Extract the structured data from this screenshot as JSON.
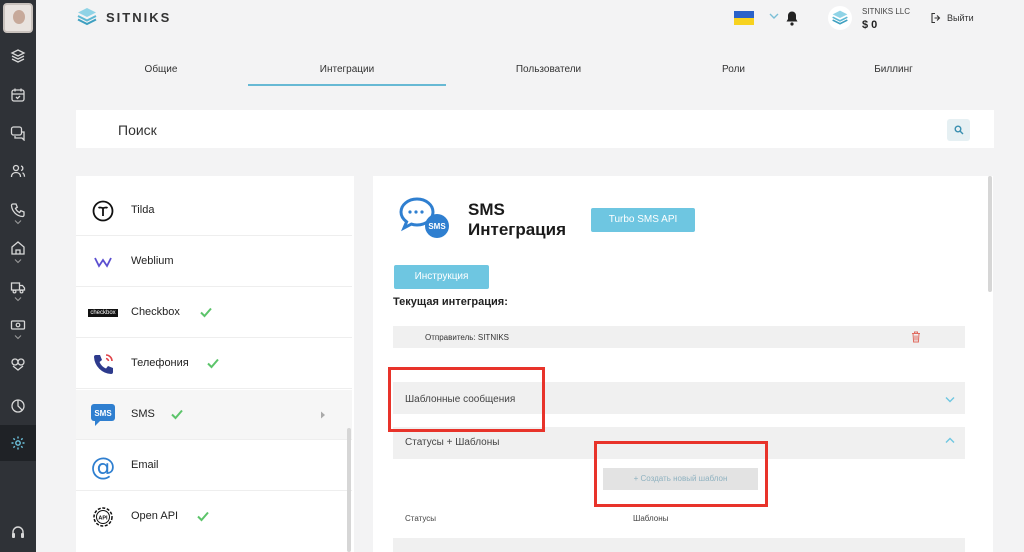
{
  "brand": {
    "name": "SITNIKS",
    "accent": "#6ec6e1",
    "sidebar_bg": "#2f3237",
    "highlight": "#e8332a"
  },
  "header": {
    "account_name": "SITNIKS LLC",
    "balance": "$ 0",
    "logout": "Выйти"
  },
  "sidebar_icons": [
    "layers-icon",
    "calendar-icon",
    "chat-icon",
    "users-icon",
    "phone-icon",
    "home-icon",
    "truck-icon",
    "cash-icon",
    "handshake-icon",
    "pie-chart-icon",
    "settings-icon",
    "headset-icon"
  ],
  "tabs": [
    {
      "label": "Общие",
      "active": false
    },
    {
      "label": "Интеграции",
      "active": true
    },
    {
      "label": "Пользователи",
      "active": false
    },
    {
      "label": "Роли",
      "active": false
    },
    {
      "label": "Биллинг",
      "active": false
    }
  ],
  "search": {
    "label": "Поиск"
  },
  "integrations": [
    {
      "label": "Tilda",
      "icon": "tilda-icon",
      "connected": false
    },
    {
      "label": "Weblium",
      "icon": "weblium-icon",
      "connected": false
    },
    {
      "label": "Checkbox",
      "icon": "checkbox-logo-icon",
      "icon_text": "checkbox",
      "connected": true
    },
    {
      "label": "Телефония",
      "icon": "phone-icon",
      "connected": true
    },
    {
      "label": "SMS",
      "icon": "sms-icon",
      "icon_text": "SMS",
      "connected": true,
      "selected": true
    },
    {
      "label": "Email",
      "icon": "at-icon",
      "connected": false
    },
    {
      "label": "Open API",
      "icon": "api-gear-icon",
      "icon_text": "API",
      "connected": true
    }
  ],
  "sms_panel": {
    "title_line1": "SMS",
    "title_line2": "Интеграция",
    "logo_text": "SMS",
    "provider_button": "Turbo SMS API",
    "instruction_button": "Инструкция",
    "current_integration_label": "Текущая интеграция:",
    "sender": "Отправитель: SITNIKS",
    "accordion_templates": "Шаблонные сообщения",
    "accordion_statuses": "Статусы + Шаблоны",
    "create_template_button": "+ Создать новый шаблон",
    "col_statuses": "Статусы",
    "col_templates": "Шаблоны"
  }
}
